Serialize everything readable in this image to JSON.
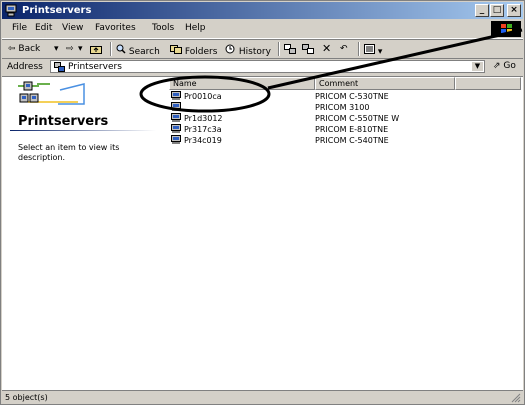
{
  "window": {
    "title": "Printservers"
  },
  "title_buttons": [
    "_",
    "□",
    "×"
  ],
  "menu": [
    "File",
    "Edit",
    "View",
    "Favorites",
    "Tools",
    "Help"
  ],
  "toolbar": {
    "back": "⇦ Back",
    "forward": "⇨",
    "search": "Search",
    "folders": "Folders",
    "history": "History"
  },
  "address": {
    "label": "Address",
    "value": "Printservers",
    "go": "Go"
  },
  "left_pane": {
    "title": "Printservers",
    "description": "Select an item to view its description."
  },
  "list": {
    "columns": [
      "Name",
      "Comment"
    ],
    "rows": [
      {
        "name": "Pr0010ca",
        "comment": "PRICOM C-530TNE"
      },
      {
        "name": "",
        "comment": "PRICOM 3100"
      },
      {
        "name": "Pr1d3012",
        "comment": "PRICOM C-550TNE W"
      },
      {
        "name": "Pr317c3a",
        "comment": "PRICOM E-810TNE"
      },
      {
        "name": "Pr34c019",
        "comment": "PRICOM C-540TNE"
      }
    ]
  },
  "status": {
    "text": "5 object(s)"
  },
  "colors": {
    "titlebar_start": "#0a246a",
    "titlebar_end": "#a6caf0",
    "chrome": "#d4d0c8"
  },
  "icons": [
    "computer-icon",
    "printer-server-icon",
    "search-icon",
    "folders-icon",
    "history-icon",
    "windows-flag-icon",
    "go-icon"
  ]
}
